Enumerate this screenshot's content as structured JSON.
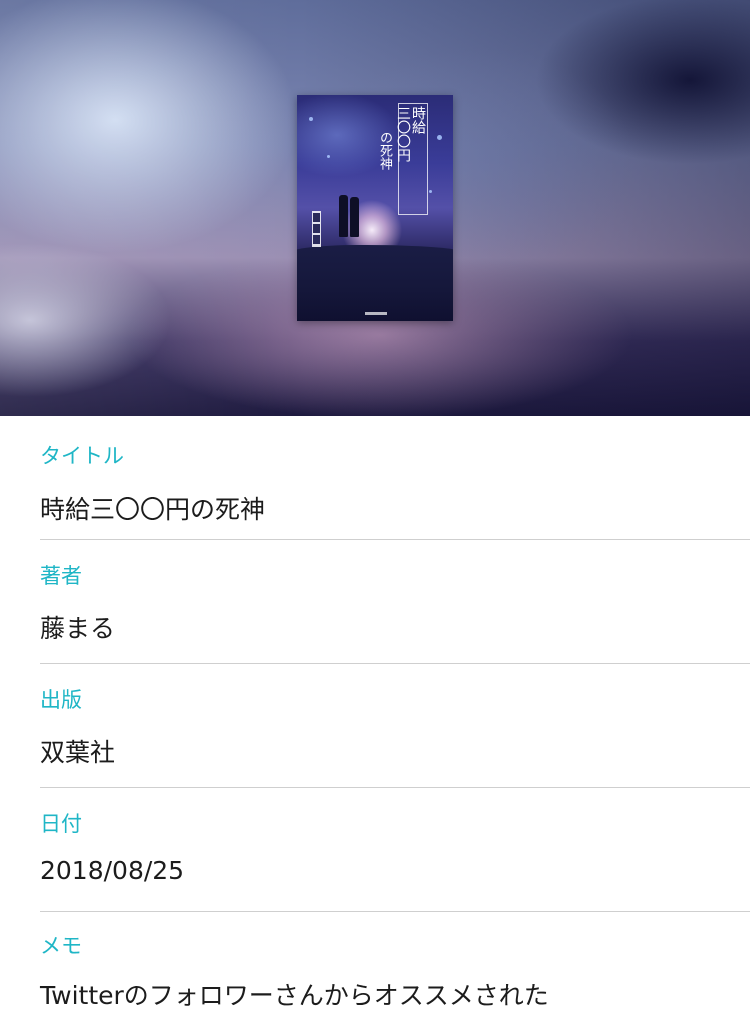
{
  "cover": {
    "title_line1": "時給",
    "title_line2": "三〇〇円",
    "title_line3": "の死神"
  },
  "fields": [
    {
      "label": "タイトル",
      "value": "時給三〇〇円の死神"
    },
    {
      "label": "著者",
      "value": "藤まる"
    },
    {
      "label": "出版",
      "value": "双葉社"
    },
    {
      "label": "日付",
      "value": "2018/08/25"
    },
    {
      "label": "メモ",
      "value": "Twitterのフォロワーさんからオススメされた"
    }
  ],
  "colors": {
    "label": "#1fb6c6",
    "value": "#1c1c1c",
    "divider": "#cfcfcf"
  }
}
